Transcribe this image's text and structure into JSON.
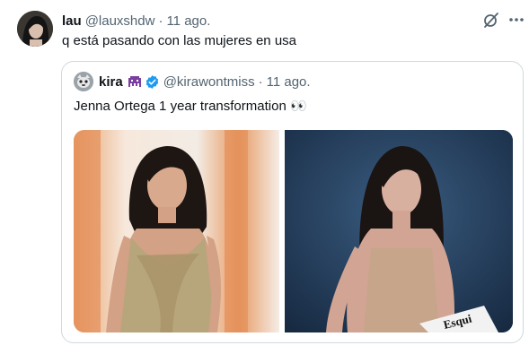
{
  "tweet": {
    "author_name": "lau",
    "author_handle": "@lauxshdw",
    "separator": "·",
    "date": "11 ago.",
    "text": "q está pasando con las mujeres en usa"
  },
  "quoted": {
    "author_name": "kira",
    "author_handle": "@kirawontmiss",
    "separator": "·",
    "date": "11 ago.",
    "text": "Jenna Ortega 1 year transformation 👀",
    "images": [
      {
        "description_icon": "photo-red-carpet"
      },
      {
        "description_icon": "photo-interview"
      }
    ],
    "magazine_card_text": "Esqui"
  },
  "icons": {
    "grok": "grok-icon",
    "more": "more-icon",
    "verified": "verified-badge-icon",
    "alien": "alien-emoji-icon"
  },
  "colors": {
    "text": "#0f1419",
    "muted": "#536471",
    "border": "#cfd9de",
    "verified": "#1d9bf0",
    "alien": "#7b3fa0"
  }
}
